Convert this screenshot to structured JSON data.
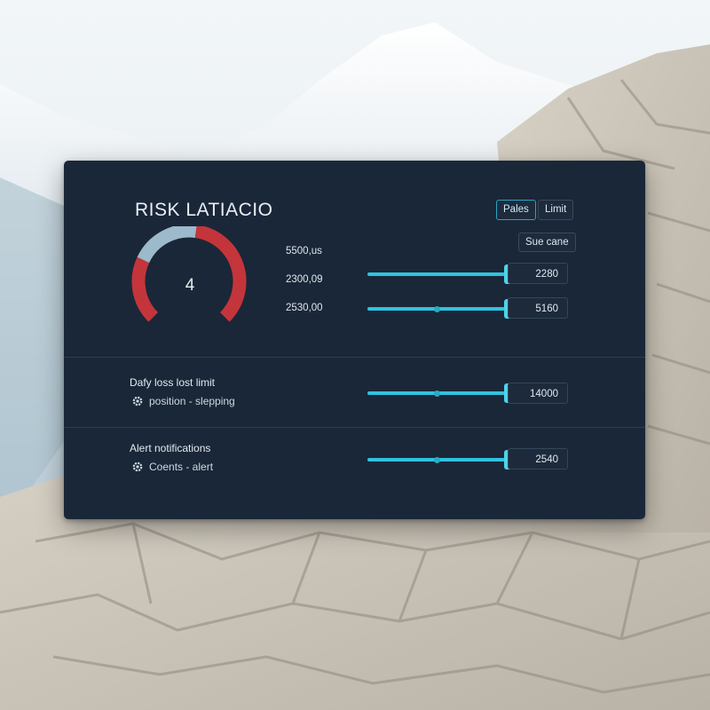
{
  "header": {
    "title": "RISK LATIACIO",
    "tabs": [
      "Pales",
      "Limit"
    ],
    "active_tab": "Pales",
    "sub_button": "Sue cane"
  },
  "gauge": {
    "value": "4",
    "level_fraction": 0.73,
    "colors": {
      "filled": "#c4353b",
      "empty": "#9db9cc"
    }
  },
  "stats": [
    "5500,us",
    "2300,09",
    "2530,00"
  ],
  "sliders": [
    {
      "value": "2280",
      "fill_fraction": 1.0
    },
    {
      "value": "5160",
      "fill_fraction": 1.0
    },
    {
      "value": "14000",
      "fill_fraction": 1.0
    },
    {
      "value": "2540",
      "fill_fraction": 1.0
    }
  ],
  "sections": {
    "daily_loss": {
      "title": "Dafy loss lost limit",
      "subtitle": "position - slepping",
      "icon": "gear-icon"
    },
    "alerts": {
      "title": "Alert notifications",
      "subtitle": "Coents - alert",
      "icon": "gear-icon"
    }
  },
  "colors": {
    "panel": "#1a2738",
    "accent": "#2fc3df",
    "danger": "#c4353b"
  }
}
